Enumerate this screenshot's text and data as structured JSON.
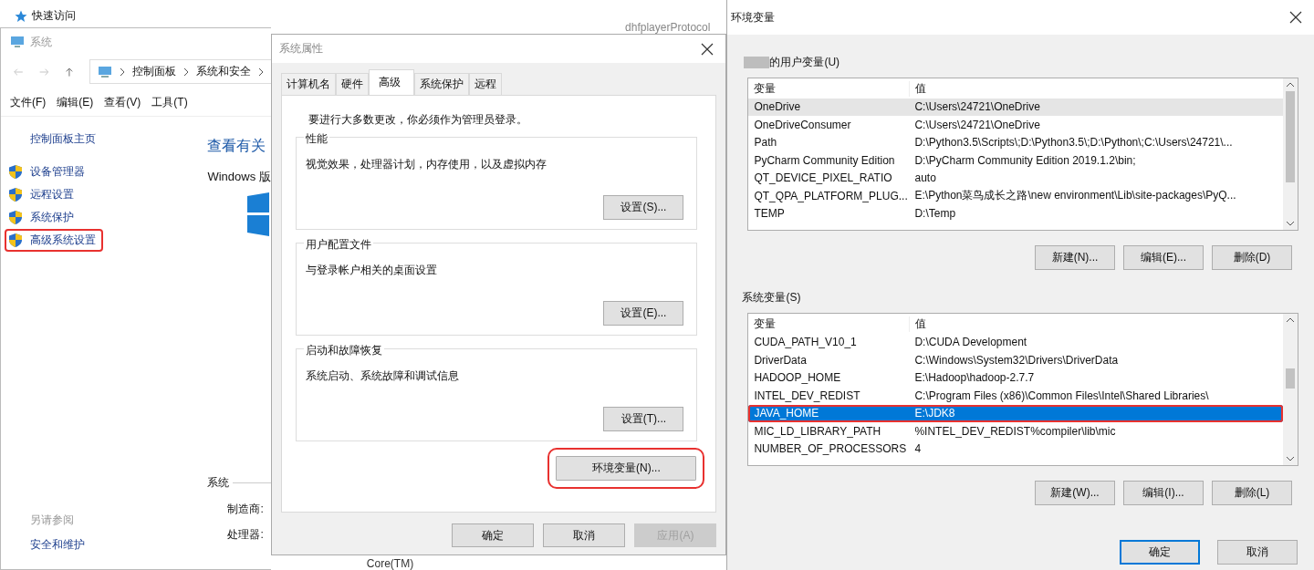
{
  "background_explorer": {
    "quick_access": "快速访问",
    "type_cell": "dhfplayerProtocol",
    "bottom_text": "Core(TM)"
  },
  "system_window": {
    "title": "系统",
    "breadcrumb": [
      "控制面板",
      "系统和安全"
    ],
    "menu": [
      "文件(F)",
      "编辑(E)",
      "查看(V)",
      "工具(T)"
    ],
    "home_link": "控制面板主页",
    "tasks": [
      {
        "label": "设备管理器",
        "highlighted": false
      },
      {
        "label": "远程设置",
        "highlighted": false
      },
      {
        "label": "系统保护",
        "highlighted": false
      },
      {
        "label": "高级系统设置",
        "highlighted": true
      }
    ],
    "heading": "查看有关",
    "edition": "Windows 版",
    "see_also_title": "另请参阅",
    "see_also_links": [
      "安全和维护"
    ],
    "section_title": "系统",
    "fields": [
      "制造商:",
      "处理器:"
    ]
  },
  "properties_dialog": {
    "title": "系统属性",
    "tabs": [
      {
        "label": "计算机名",
        "selected": false
      },
      {
        "label": "硬件",
        "selected": false
      },
      {
        "label": "高级",
        "selected": true
      },
      {
        "label": "系统保护",
        "selected": false
      },
      {
        "label": "远程",
        "selected": false
      }
    ],
    "note": "要进行大多数更改，你必须作为管理员登录。",
    "groups": [
      {
        "title": "性能",
        "description": "视觉效果，处理器计划，内存使用，以及虚拟内存",
        "button": "设置(S)..."
      },
      {
        "title": "用户配置文件",
        "description": "与登录帐户相关的桌面设置",
        "button": "设置(E)..."
      },
      {
        "title": "启动和故障恢复",
        "description": "系统启动、系统故障和调试信息",
        "button": "设置(T)..."
      }
    ],
    "env_button": {
      "label": "环境变量(N)...",
      "highlighted": true
    },
    "footer": [
      {
        "label": "确定",
        "disabled": false
      },
      {
        "label": "取消",
        "disabled": false
      },
      {
        "label": "应用(A)",
        "disabled": true
      }
    ]
  },
  "env_dialog": {
    "title": "环境变量",
    "sections": [
      {
        "label": "的用户变量(U)",
        "name_redacted": true,
        "focused": false,
        "columns": [
          "变量",
          "值"
        ],
        "rows": [
          {
            "name": "OneDrive",
            "value": "C:\\Users\\24721\\OneDrive",
            "selected": true,
            "highlighted": false
          },
          {
            "name": "OneDriveConsumer",
            "value": "C:\\Users\\24721\\OneDrive",
            "selected": false,
            "highlighted": false
          },
          {
            "name": "Path",
            "value": "D:\\Python3.5\\Scripts\\;D:\\Python3.5\\;D:\\Python\\;C:\\Users\\24721\\...",
            "selected": false,
            "highlighted": false
          },
          {
            "name": "PyCharm Community Edition",
            "value": "D:\\PyCharm Community Edition 2019.1.2\\bin;",
            "selected": false,
            "highlighted": false
          },
          {
            "name": "QT_DEVICE_PIXEL_RATIO",
            "value": "auto",
            "selected": false,
            "highlighted": false
          },
          {
            "name": "QT_QPA_PLATFORM_PLUG...",
            "value": "E:\\Python菜鸟成长之路\\new environment\\Lib\\site-packages\\PyQ...",
            "selected": false,
            "highlighted": false
          },
          {
            "name": "TEMP",
            "value": "D:\\Temp",
            "selected": false,
            "highlighted": false
          }
        ],
        "buttons": [
          "新建(N)...",
          "编辑(E)...",
          "删除(D)"
        ]
      },
      {
        "label": "系统变量(S)",
        "name_redacted": false,
        "focused": true,
        "columns": [
          "变量",
          "值"
        ],
        "rows": [
          {
            "name": "CUDA_PATH_V10_1",
            "value": "D:\\CUDA Development",
            "selected": false,
            "highlighted": false
          },
          {
            "name": "DriverData",
            "value": "C:\\Windows\\System32\\Drivers\\DriverData",
            "selected": false,
            "highlighted": false
          },
          {
            "name": "HADOOP_HOME",
            "value": "E:\\Hadoop\\hadoop-2.7.7",
            "selected": false,
            "highlighted": false
          },
          {
            "name": "INTEL_DEV_REDIST",
            "value": "C:\\Program Files (x86)\\Common Files\\Intel\\Shared Libraries\\",
            "selected": false,
            "highlighted": false
          },
          {
            "name": "JAVA_HOME",
            "value": "E:\\JDK8",
            "selected": true,
            "highlighted": true
          },
          {
            "name": "MIC_LD_LIBRARY_PATH",
            "value": "%INTEL_DEV_REDIST%compiler\\lib\\mic",
            "selected": false,
            "highlighted": false
          },
          {
            "name": "NUMBER_OF_PROCESSORS",
            "value": "4",
            "selected": false,
            "highlighted": false
          }
        ],
        "buttons": [
          "新建(W)...",
          "编辑(I)...",
          "删除(L)"
        ]
      }
    ],
    "footer": [
      {
        "label": "确定",
        "focused": true
      },
      {
        "label": "取消",
        "focused": false
      }
    ]
  }
}
